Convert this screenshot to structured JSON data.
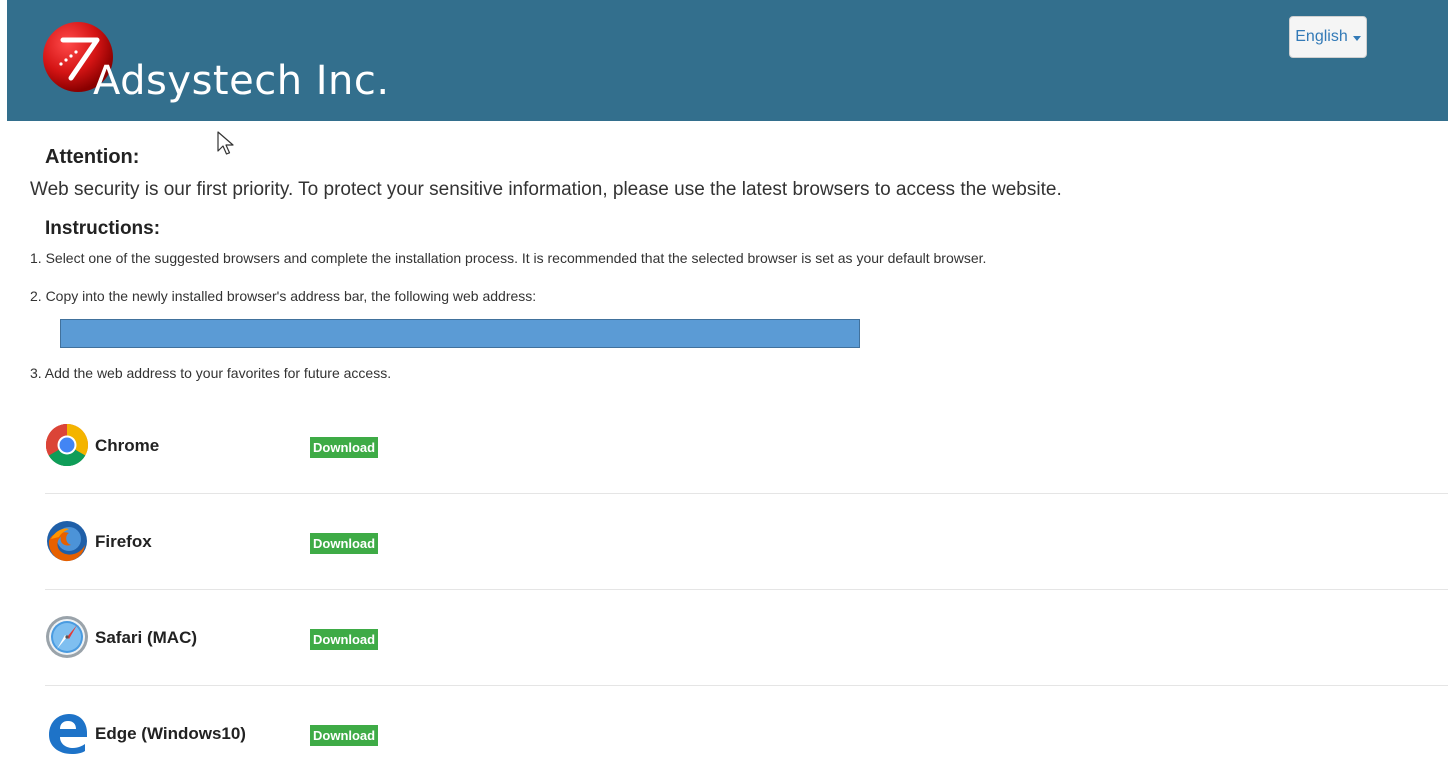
{
  "header": {
    "company_name": "Adsystech Inc.",
    "background_color": "#336f8d",
    "language_selector": {
      "label": "English",
      "icon": "caret-down-icon"
    }
  },
  "notice": {
    "attention_heading": "Attention:",
    "attention_text": "Web security is our first priority. To protect your sensitive information, please use the latest browsers to access the website.",
    "instructions_heading": "Instructions:",
    "steps": [
      "1. Select one of the suggested browsers and complete the installation process. It is recommended that the selected browser is set as your default browser.",
      "2. Copy into the newly installed browser's address bar, the following web address:",
      "3. Add the web address to your favorites for future access."
    ],
    "web_address": ""
  },
  "browsers": [
    {
      "name": "Chrome",
      "icon": "chrome-icon",
      "download_label": "Download"
    },
    {
      "name": "Firefox",
      "icon": "firefox-icon",
      "download_label": "Download"
    },
    {
      "name": "Safari (MAC)",
      "icon": "safari-icon",
      "download_label": "Download"
    },
    {
      "name": "Edge (Windows10)",
      "icon": "edge-icon",
      "download_label": "Download"
    }
  ],
  "colors": {
    "header": "#336f8d",
    "download_button": "#3eab46",
    "address_box": "#5b9bd5"
  }
}
